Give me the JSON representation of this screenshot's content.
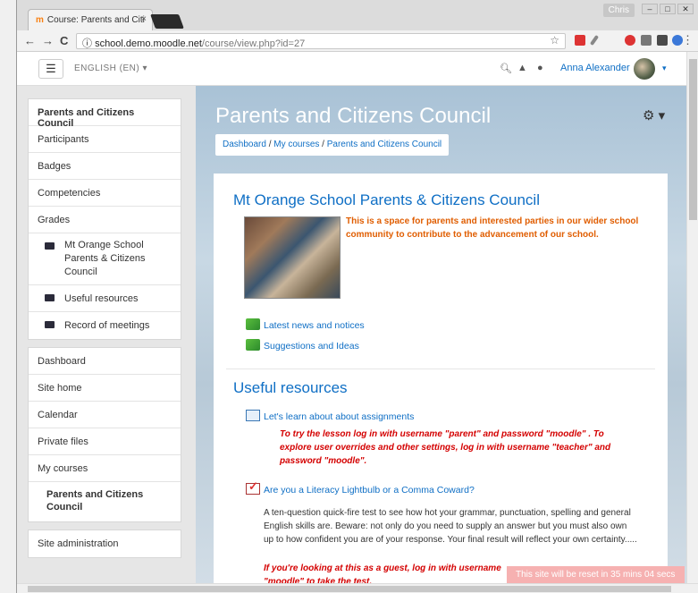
{
  "browser": {
    "tab_title": "Course: Parents and Citi",
    "tab_icon": "m",
    "profile": "Chris",
    "url_host": "school.demo.moodle.net",
    "url_path": "/course/view.php?id=27",
    "info_icon": "ⓘ"
  },
  "moodle_nav": {
    "language": "ENGLISH (EN)",
    "user_name": "Anna Alexander"
  },
  "drawer": {
    "course_block": [
      {
        "label": "Parents and Citizens Council",
        "type": "heading"
      },
      {
        "label": "Participants",
        "type": "link"
      },
      {
        "label": "Badges",
        "type": "link"
      },
      {
        "label": "Competencies",
        "type": "link"
      },
      {
        "label": "Grades",
        "type": "link"
      },
      {
        "label": "Mt Orange School Parents & Citizens Council",
        "type": "section"
      },
      {
        "label": "Useful resources",
        "type": "section"
      },
      {
        "label": "Record of meetings",
        "type": "section"
      }
    ],
    "site_block": [
      {
        "label": "Dashboard"
      },
      {
        "label": "Site home"
      },
      {
        "label": "Calendar"
      },
      {
        "label": "Private files"
      },
      {
        "label": "My courses"
      },
      {
        "label": "Parents and Citizens Council"
      }
    ],
    "admin_block": [
      {
        "label": "Site administration"
      }
    ]
  },
  "header": {
    "title": "Parents and Citizens Council",
    "breadcrumb": [
      "Dashboard",
      "My courses",
      "Parents and Citizens Council"
    ]
  },
  "content": {
    "section1_title": "Mt Orange School Parents & Citizens Council",
    "section1_intro": "This is a space for parents and interested parties in our wider school community to contribute to the advancement of our school.",
    "forums": [
      "Latest news and notices",
      "Suggestions and Ideas"
    ],
    "section2_title": "Useful resources",
    "lesson": "Let's learn about about assignments",
    "lesson_note": "To try the lesson log in with username \"parent\" and password \"moodle\" . To explore user overrides and other settings, log in with username \"teacher\" and password \"moodle\".",
    "quiz": "Are you a Literacy Lightbulb or a Comma Coward?",
    "quiz_desc": "A ten-question quick-fire test to see how hot your grammar, punctuation, spelling and general English skills are. Beware: not only do you need to supply an answer but you must also own up to how confident you are of your response. Your final result will reflect your own certainty.....",
    "quiz_note": "If you're looking at this as a guest, log in with username",
    "quiz_note2": "\"moodle\" to take the test."
  },
  "notice": "This site will be reset in 35 mins 04 secs",
  "colors": {
    "link": "#0f6fc5",
    "intro_orange": "#e05d00",
    "note_red": "#d40000",
    "notice_bg": "#f6b1b1"
  }
}
